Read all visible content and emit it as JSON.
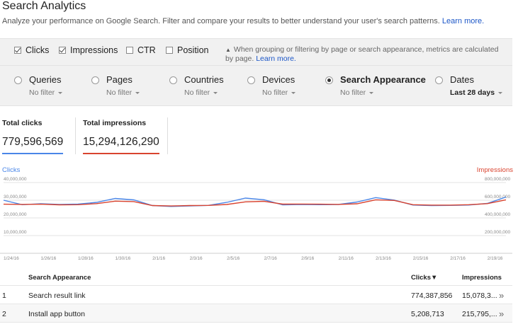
{
  "page": {
    "title": "Search Analytics",
    "subtitle": "Analyze your performance on Google Search. Filter and compare your results to better understand your user's search patterns.",
    "learn_more": "Learn more."
  },
  "metrics": {
    "items": [
      {
        "label": "Clicks",
        "checked": true
      },
      {
        "label": "Impressions",
        "checked": true
      },
      {
        "label": "CTR",
        "checked": false
      },
      {
        "label": "Position",
        "checked": false
      }
    ],
    "note": "When grouping or filtering by page or search appearance, metrics are calculated by page.",
    "note_link": "Learn more."
  },
  "dimensions": [
    {
      "label": "Queries",
      "filter": "No filter",
      "selected": false
    },
    {
      "label": "Pages",
      "filter": "No filter",
      "selected": false
    },
    {
      "label": "Countries",
      "filter": "No filter",
      "selected": false
    },
    {
      "label": "Devices",
      "filter": "No filter",
      "selected": false
    },
    {
      "label": "Search Appearance",
      "filter": "No filter",
      "selected": true
    },
    {
      "label": "Dates",
      "filter": "Last 28 days",
      "selected": false
    }
  ],
  "totals": {
    "clicks_label": "Total clicks",
    "clicks_value": "779,596,569",
    "impressions_label": "Total impressions",
    "impressions_value": "15,294,126,290"
  },
  "chart_data": {
    "type": "line",
    "left_axis_title": "Clicks",
    "right_axis_title": "Impressions",
    "left_ticks": [
      "40,000,000",
      "30,000,000",
      "20,000,000",
      "10,000,000"
    ],
    "right_ticks": [
      "800,000,000",
      "600,000,000",
      "400,000,000",
      "200,000,000"
    ],
    "left_ylim": [
      0,
      40000000
    ],
    "right_ylim": [
      0,
      800000000
    ],
    "x_tick_labels": [
      "1/24/16",
      "1/26/16",
      "1/28/16",
      "1/30/16",
      "2/1/16",
      "2/3/16",
      "2/5/16",
      "2/7/16",
      "2/9/16",
      "2/11/16",
      "2/13/16",
      "2/15/16",
      "2/17/16",
      "2/19/16"
    ],
    "series": [
      {
        "name": "Clicks",
        "axis": "left",
        "color": "#4a86e8",
        "values": [
          30000000,
          27500000,
          28000000,
          27600000,
          27800000,
          28800000,
          31000000,
          30200000,
          27000000,
          26500000,
          26800000,
          27100000,
          28800000,
          31200000,
          30300000,
          27400000,
          27600000,
          27500000,
          27600000,
          29000000,
          31500000,
          30100000,
          27300000,
          27000000,
          27100000,
          27300000,
          28200000,
          31800000
        ]
      },
      {
        "name": "Impressions",
        "axis": "right",
        "color": "#d9432f",
        "values": [
          555000000,
          553000000,
          555000000,
          548000000,
          550000000,
          562000000,
          590000000,
          585000000,
          540000000,
          535000000,
          540000000,
          542000000,
          552000000,
          582000000,
          588000000,
          556000000,
          557000000,
          555000000,
          553000000,
          560000000,
          605000000,
          598000000,
          550000000,
          545000000,
          545000000,
          550000000,
          562000000,
          605000000
        ]
      }
    ]
  },
  "table": {
    "headers": {
      "name": "Search Appearance",
      "clicks": "Clicks",
      "sort": "▼",
      "impressions": "Impressions"
    },
    "rows": [
      {
        "index": "1",
        "name": "Search result link",
        "clicks": "774,387,856",
        "impressions": "15,078,3..."
      },
      {
        "index": "2",
        "name": "Install app button",
        "clicks": "5,208,713",
        "impressions": "215,795,..."
      }
    ]
  },
  "colors": {
    "link": "#1a55c7",
    "clicks": "#4a86e8",
    "impressions": "#d9432f"
  }
}
